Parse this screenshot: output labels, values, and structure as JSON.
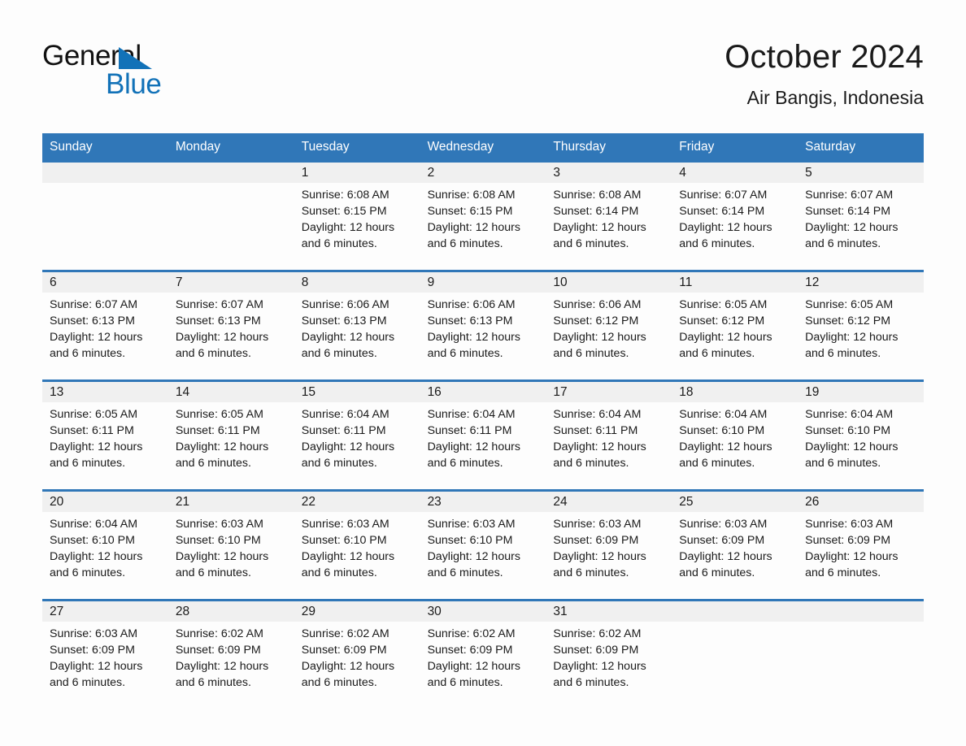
{
  "brand": {
    "name_part1": "General",
    "name_part2": "Blue"
  },
  "header": {
    "title": "October 2024",
    "location": "Air Bangis, Indonesia"
  },
  "colors": {
    "header_blue": "#3077B8",
    "logo_blue": "#1272B8",
    "day_band_gray": "#F0F0F0",
    "text": "#1A1A1A"
  },
  "calendar": {
    "weekday_headers": [
      "Sunday",
      "Monday",
      "Tuesday",
      "Wednesday",
      "Thursday",
      "Friday",
      "Saturday"
    ],
    "weeks": [
      [
        {
          "day": "",
          "sunrise": "",
          "sunset": "",
          "daylight": "",
          "daylight2": ""
        },
        {
          "day": "",
          "sunrise": "",
          "sunset": "",
          "daylight": "",
          "daylight2": ""
        },
        {
          "day": "1",
          "sunrise": "Sunrise: 6:08 AM",
          "sunset": "Sunset: 6:15 PM",
          "daylight": "Daylight: 12 hours",
          "daylight2": "and 6 minutes."
        },
        {
          "day": "2",
          "sunrise": "Sunrise: 6:08 AM",
          "sunset": "Sunset: 6:15 PM",
          "daylight": "Daylight: 12 hours",
          "daylight2": "and 6 minutes."
        },
        {
          "day": "3",
          "sunrise": "Sunrise: 6:08 AM",
          "sunset": "Sunset: 6:14 PM",
          "daylight": "Daylight: 12 hours",
          "daylight2": "and 6 minutes."
        },
        {
          "day": "4",
          "sunrise": "Sunrise: 6:07 AM",
          "sunset": "Sunset: 6:14 PM",
          "daylight": "Daylight: 12 hours",
          "daylight2": "and 6 minutes."
        },
        {
          "day": "5",
          "sunrise": "Sunrise: 6:07 AM",
          "sunset": "Sunset: 6:14 PM",
          "daylight": "Daylight: 12 hours",
          "daylight2": "and 6 minutes."
        }
      ],
      [
        {
          "day": "6",
          "sunrise": "Sunrise: 6:07 AM",
          "sunset": "Sunset: 6:13 PM",
          "daylight": "Daylight: 12 hours",
          "daylight2": "and 6 minutes."
        },
        {
          "day": "7",
          "sunrise": "Sunrise: 6:07 AM",
          "sunset": "Sunset: 6:13 PM",
          "daylight": "Daylight: 12 hours",
          "daylight2": "and 6 minutes."
        },
        {
          "day": "8",
          "sunrise": "Sunrise: 6:06 AM",
          "sunset": "Sunset: 6:13 PM",
          "daylight": "Daylight: 12 hours",
          "daylight2": "and 6 minutes."
        },
        {
          "day": "9",
          "sunrise": "Sunrise: 6:06 AM",
          "sunset": "Sunset: 6:13 PM",
          "daylight": "Daylight: 12 hours",
          "daylight2": "and 6 minutes."
        },
        {
          "day": "10",
          "sunrise": "Sunrise: 6:06 AM",
          "sunset": "Sunset: 6:12 PM",
          "daylight": "Daylight: 12 hours",
          "daylight2": "and 6 minutes."
        },
        {
          "day": "11",
          "sunrise": "Sunrise: 6:05 AM",
          "sunset": "Sunset: 6:12 PM",
          "daylight": "Daylight: 12 hours",
          "daylight2": "and 6 minutes."
        },
        {
          "day": "12",
          "sunrise": "Sunrise: 6:05 AM",
          "sunset": "Sunset: 6:12 PM",
          "daylight": "Daylight: 12 hours",
          "daylight2": "and 6 minutes."
        }
      ],
      [
        {
          "day": "13",
          "sunrise": "Sunrise: 6:05 AM",
          "sunset": "Sunset: 6:11 PM",
          "daylight": "Daylight: 12 hours",
          "daylight2": "and 6 minutes."
        },
        {
          "day": "14",
          "sunrise": "Sunrise: 6:05 AM",
          "sunset": "Sunset: 6:11 PM",
          "daylight": "Daylight: 12 hours",
          "daylight2": "and 6 minutes."
        },
        {
          "day": "15",
          "sunrise": "Sunrise: 6:04 AM",
          "sunset": "Sunset: 6:11 PM",
          "daylight": "Daylight: 12 hours",
          "daylight2": "and 6 minutes."
        },
        {
          "day": "16",
          "sunrise": "Sunrise: 6:04 AM",
          "sunset": "Sunset: 6:11 PM",
          "daylight": "Daylight: 12 hours",
          "daylight2": "and 6 minutes."
        },
        {
          "day": "17",
          "sunrise": "Sunrise: 6:04 AM",
          "sunset": "Sunset: 6:11 PM",
          "daylight": "Daylight: 12 hours",
          "daylight2": "and 6 minutes."
        },
        {
          "day": "18",
          "sunrise": "Sunrise: 6:04 AM",
          "sunset": "Sunset: 6:10 PM",
          "daylight": "Daylight: 12 hours",
          "daylight2": "and 6 minutes."
        },
        {
          "day": "19",
          "sunrise": "Sunrise: 6:04 AM",
          "sunset": "Sunset: 6:10 PM",
          "daylight": "Daylight: 12 hours",
          "daylight2": "and 6 minutes."
        }
      ],
      [
        {
          "day": "20",
          "sunrise": "Sunrise: 6:04 AM",
          "sunset": "Sunset: 6:10 PM",
          "daylight": "Daylight: 12 hours",
          "daylight2": "and 6 minutes."
        },
        {
          "day": "21",
          "sunrise": "Sunrise: 6:03 AM",
          "sunset": "Sunset: 6:10 PM",
          "daylight": "Daylight: 12 hours",
          "daylight2": "and 6 minutes."
        },
        {
          "day": "22",
          "sunrise": "Sunrise: 6:03 AM",
          "sunset": "Sunset: 6:10 PM",
          "daylight": "Daylight: 12 hours",
          "daylight2": "and 6 minutes."
        },
        {
          "day": "23",
          "sunrise": "Sunrise: 6:03 AM",
          "sunset": "Sunset: 6:10 PM",
          "daylight": "Daylight: 12 hours",
          "daylight2": "and 6 minutes."
        },
        {
          "day": "24",
          "sunrise": "Sunrise: 6:03 AM",
          "sunset": "Sunset: 6:09 PM",
          "daylight": "Daylight: 12 hours",
          "daylight2": "and 6 minutes."
        },
        {
          "day": "25",
          "sunrise": "Sunrise: 6:03 AM",
          "sunset": "Sunset: 6:09 PM",
          "daylight": "Daylight: 12 hours",
          "daylight2": "and 6 minutes."
        },
        {
          "day": "26",
          "sunrise": "Sunrise: 6:03 AM",
          "sunset": "Sunset: 6:09 PM",
          "daylight": "Daylight: 12 hours",
          "daylight2": "and 6 minutes."
        }
      ],
      [
        {
          "day": "27",
          "sunrise": "Sunrise: 6:03 AM",
          "sunset": "Sunset: 6:09 PM",
          "daylight": "Daylight: 12 hours",
          "daylight2": "and 6 minutes."
        },
        {
          "day": "28",
          "sunrise": "Sunrise: 6:02 AM",
          "sunset": "Sunset: 6:09 PM",
          "daylight": "Daylight: 12 hours",
          "daylight2": "and 6 minutes."
        },
        {
          "day": "29",
          "sunrise": "Sunrise: 6:02 AM",
          "sunset": "Sunset: 6:09 PM",
          "daylight": "Daylight: 12 hours",
          "daylight2": "and 6 minutes."
        },
        {
          "day": "30",
          "sunrise": "Sunrise: 6:02 AM",
          "sunset": "Sunset: 6:09 PM",
          "daylight": "Daylight: 12 hours",
          "daylight2": "and 6 minutes."
        },
        {
          "day": "31",
          "sunrise": "Sunrise: 6:02 AM",
          "sunset": "Sunset: 6:09 PM",
          "daylight": "Daylight: 12 hours",
          "daylight2": "and 6 minutes."
        },
        {
          "day": "",
          "sunrise": "",
          "sunset": "",
          "daylight": "",
          "daylight2": ""
        },
        {
          "day": "",
          "sunrise": "",
          "sunset": "",
          "daylight": "",
          "daylight2": ""
        }
      ]
    ]
  }
}
